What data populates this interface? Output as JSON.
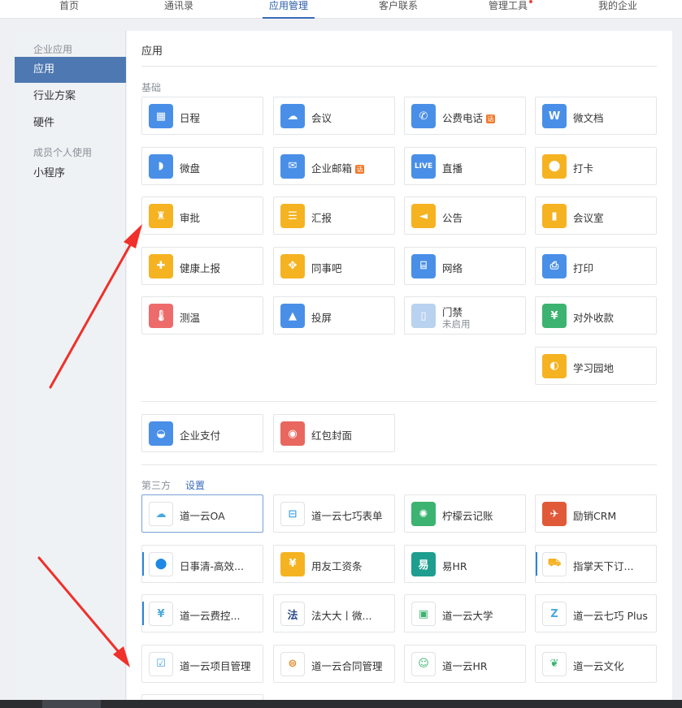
{
  "nav": {
    "items": [
      {
        "label": "首页",
        "active": false
      },
      {
        "label": "通讯录",
        "active": false
      },
      {
        "label": "应用管理",
        "active": true
      },
      {
        "label": "客户联系",
        "active": false
      },
      {
        "label": "管理工具",
        "active": false,
        "dot": true
      },
      {
        "label": "我的企业",
        "active": false
      }
    ]
  },
  "sidebar": {
    "group1": "企业应用",
    "items1": [
      "应用",
      "行业方案",
      "硬件"
    ],
    "group2": "成员个人使用",
    "items2": [
      "小程序"
    ]
  },
  "main": {
    "title": "应用",
    "basic_label": "基础",
    "third_label": "第三方",
    "third_settings": "设置",
    "basic_apps": [
      {
        "label": "日程",
        "icon": "calendar-icon",
        "color": "#4a8fe7"
      },
      {
        "label": "会议",
        "icon": "cloud-meeting-icon",
        "color": "#4a8fe7"
      },
      {
        "label": "公费电话",
        "icon": "phone-icon",
        "color": "#4a8fe7",
        "badge": "话"
      },
      {
        "label": "微文档",
        "icon": "w-doc-icon",
        "color": "#4a8fe7"
      },
      {
        "label": "微盘",
        "icon": "drive-icon",
        "color": "#4a8fe7"
      },
      {
        "label": "企业邮箱",
        "icon": "mail-icon",
        "color": "#4a8fe7",
        "badge": "话"
      },
      {
        "label": "直播",
        "icon": "live-icon",
        "color": "#4a8fe7",
        "glyph": "LIVE"
      },
      {
        "label": "打卡",
        "icon": "location-pin-icon",
        "color": "#f5b322"
      },
      {
        "label": "审批",
        "icon": "stamp-icon",
        "color": "#f5b322"
      },
      {
        "label": "汇报",
        "icon": "report-icon",
        "color": "#f5b322"
      },
      {
        "label": "公告",
        "icon": "megaphone-icon",
        "color": "#f5b322"
      },
      {
        "label": "会议室",
        "icon": "door-icon",
        "color": "#f5b322"
      },
      {
        "label": "健康上报",
        "icon": "health-report-icon",
        "color": "#f5b322"
      },
      {
        "label": "同事吧",
        "icon": "colleague-icon",
        "color": "#f5b322"
      },
      {
        "label": "网络",
        "icon": "router-icon",
        "color": "#4a8fe7"
      },
      {
        "label": "打印",
        "icon": "printer-icon",
        "color": "#4a8fe7"
      },
      {
        "label": "测温",
        "icon": "thermometer-icon",
        "color": "#ee6b6b"
      },
      {
        "label": "投屏",
        "icon": "screencast-icon",
        "color": "#4a8fe7"
      },
      {
        "label": "门禁",
        "sub": "未启用",
        "icon": "door-access-icon",
        "color": "#b9d2ef"
      },
      {
        "label": "对外收款",
        "icon": "payment-shield-icon",
        "color": "#3cb371"
      },
      {
        "label": "学习园地",
        "icon": "planet-icon",
        "color": "#f5b322"
      }
    ],
    "extra_apps": [
      {
        "label": "企业支付",
        "icon": "wallet-icon",
        "color": "#4a8fe7"
      },
      {
        "label": "红包封面",
        "icon": "red-envelope-icon",
        "color": "#e8675e"
      }
    ],
    "third_apps": [
      {
        "label": "道一云OA",
        "icon": "cloud-oa-icon",
        "color": "#4aa8e0",
        "outline": true,
        "selected": true
      },
      {
        "label": "道一云七巧表单",
        "icon": "form-icon",
        "color": "#4aa8e0",
        "outline": true
      },
      {
        "label": "柠檬云记账",
        "icon": "lemon-icon",
        "color": "#3cb371"
      },
      {
        "label": "励销CRM",
        "icon": "crm-icon",
        "color": "#e05a3a"
      },
      {
        "label": "日事清-高效...",
        "icon": "pin-icon",
        "color": "#1e88e5",
        "outline": true,
        "bar": true
      },
      {
        "label": "用友工资条",
        "icon": "payslip-icon",
        "color": "#f5b322"
      },
      {
        "label": "易HR",
        "icon": "hr-logo-icon",
        "color": "#1e9e8f"
      },
      {
        "label": "指掌天下订...",
        "icon": "truck-icon",
        "color": "#f5b322",
        "outline": true,
        "bar": true
      },
      {
        "label": "道一云费控...",
        "icon": "expense-icon",
        "color": "#4aa8e0",
        "outline": true,
        "bar": true
      },
      {
        "label": "法大大丨微...",
        "icon": "fadada-logo-icon",
        "color": "#2a4a8a",
        "outline": true
      },
      {
        "label": "道一云大学",
        "icon": "university-icon",
        "color": "#3cb371",
        "outline": true
      },
      {
        "label": "道一云七巧 Plus",
        "icon": "z-plus-icon",
        "color": "#4aa8e0",
        "outline": true
      },
      {
        "label": "道一云项目管理",
        "icon": "project-check-icon",
        "color": "#4aa8e0",
        "outline": true
      },
      {
        "label": "道一云合同管理",
        "icon": "contract-icon",
        "color": "#e08a2a",
        "outline": true
      },
      {
        "label": "道一云HR",
        "icon": "hr-people-icon",
        "color": "#3cb371",
        "outline": true
      },
      {
        "label": "道一云文化",
        "icon": "leaf-icon",
        "color": "#3cb371",
        "outline": true
      }
    ]
  }
}
